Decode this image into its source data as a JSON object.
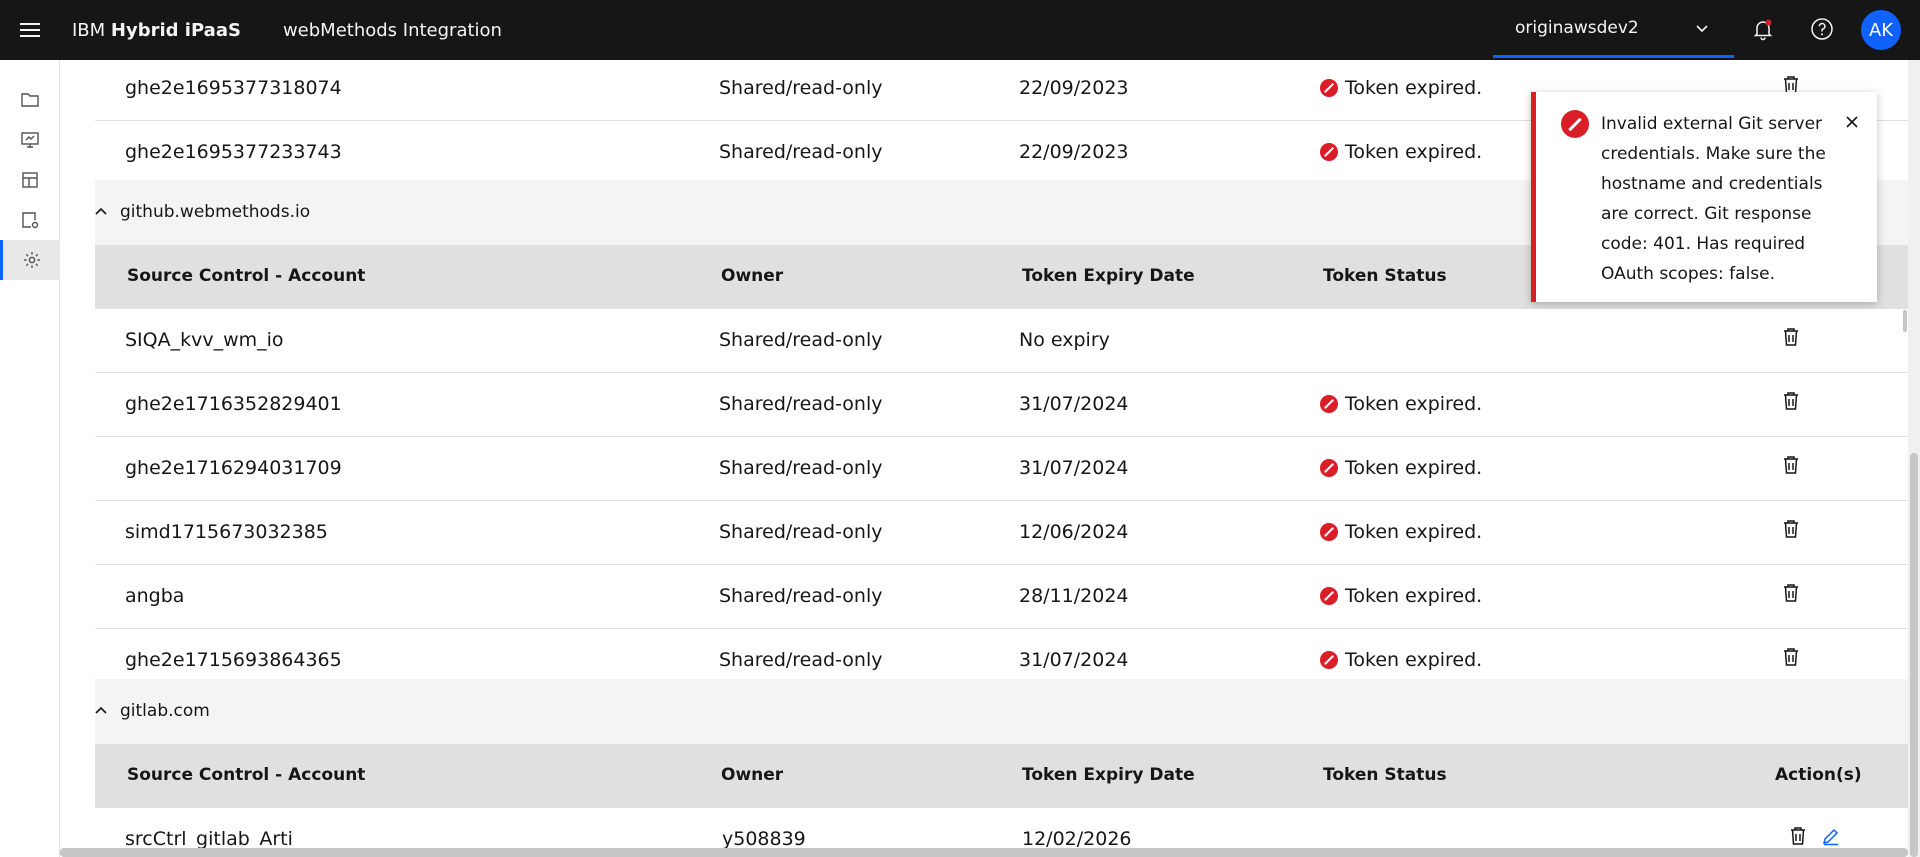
{
  "header": {
    "brand_regular": "IBM ",
    "brand_bold": "Hybrid iPaaS",
    "product": "webMethods Integration",
    "environment": "originawsdev2",
    "avatar_initials": "AK"
  },
  "groups": {
    "first": {
      "rows": [
        {
          "account": "ghe2e1695377318074",
          "owner": "Shared/read-only",
          "expiry": "22/09/2023",
          "status": "Token expired."
        },
        {
          "account": "ghe2e1695377233743",
          "owner": "Shared/read-only",
          "expiry": "22/09/2023",
          "status": "Token expired."
        }
      ]
    },
    "github": {
      "name": "github.webmethods.io",
      "columns": {
        "account": "Source Control - Account",
        "owner": "Owner",
        "expiry": "Token Expiry Date",
        "status": "Token Status"
      },
      "rows": [
        {
          "account": "SIQA_kvv_wm_io",
          "owner": "Shared/read-only",
          "expiry": "No expiry",
          "status": ""
        },
        {
          "account": "ghe2e1716352829401",
          "owner": "Shared/read-only",
          "expiry": "31/07/2024",
          "status": "Token expired."
        },
        {
          "account": "ghe2e1716294031709",
          "owner": "Shared/read-only",
          "expiry": "31/07/2024",
          "status": "Token expired."
        },
        {
          "account": "simd1715673032385",
          "owner": "Shared/read-only",
          "expiry": "12/06/2024",
          "status": "Token expired."
        },
        {
          "account": "angba",
          "owner": "Shared/read-only",
          "expiry": "28/11/2024",
          "status": "Token expired."
        },
        {
          "account": "ghe2e1715693864365",
          "owner": "Shared/read-only",
          "expiry": "31/07/2024",
          "status": "Token expired."
        }
      ]
    },
    "gitlab": {
      "name": "gitlab.com",
      "columns": {
        "account": "Source Control - Account",
        "owner": "Owner",
        "expiry": "Token Expiry Date",
        "status": "Token Status",
        "actions": "Action(s)"
      },
      "rows": [
        {
          "account": "srcCtrl_gitlab_Arti",
          "owner": "y508839",
          "expiry": "12/02/2026",
          "status": ""
        }
      ]
    }
  },
  "toast": {
    "message": "Invalid external Git server credentials. Make sure the hostname and credentials are correct. Git response code: 401. Has required OAuth scopes: false."
  },
  "colors": {
    "brand_blue": "#0f62fe",
    "error_red": "#da1e28",
    "header_bg": "#161616"
  }
}
